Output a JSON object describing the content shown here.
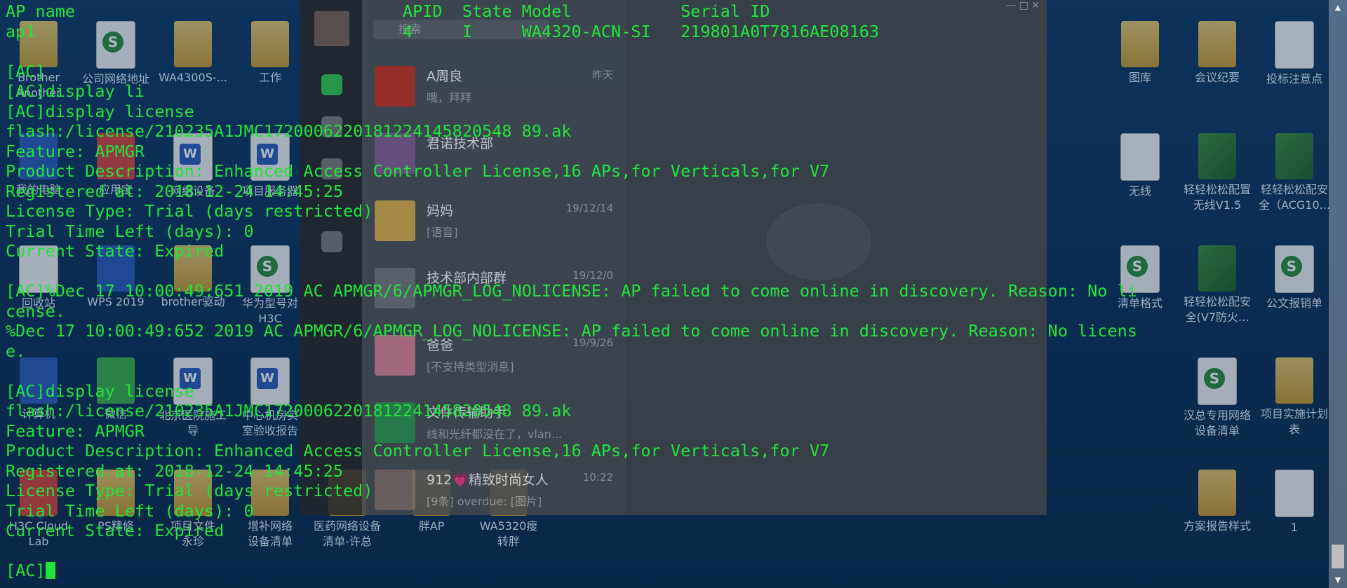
{
  "desktop": {
    "icons": [
      {
        "label": "Brother\nAnother",
        "kind": "folder"
      },
      {
        "label": "公司网络地址",
        "kind": "excel"
      },
      {
        "label": "WA4300S-...",
        "kind": "folder"
      },
      {
        "label": "工作",
        "kind": "folder"
      },
      {
        "label": "我的电脑",
        "kind": "blue"
      },
      {
        "label": "应用宝",
        "kind": "red"
      },
      {
        "label": "网络设备",
        "kind": "word"
      },
      {
        "label": "项目服务器",
        "kind": "word"
      },
      {
        "label": "回收站",
        "kind": "doc"
      },
      {
        "label": "WPS 2019",
        "kind": "blue"
      },
      {
        "label": "brother驱动",
        "kind": "folder"
      },
      {
        "label": "华为型号对\nH3C",
        "kind": "excel"
      },
      {
        "label": "计算机",
        "kind": "blue"
      },
      {
        "label": "微信",
        "kind": "green"
      },
      {
        "label": "北京医院施工\n导",
        "kind": "word"
      },
      {
        "label": "中心机房实\n室验收报告",
        "kind": "word"
      },
      {
        "label": "H3C Cloud\nLab",
        "kind": "red"
      },
      {
        "label": "PS精修",
        "kind": "folder"
      },
      {
        "label": "项目文件\n永珍",
        "kind": "folder"
      },
      {
        "label": "增补网络\n设备清单",
        "kind": "folder"
      },
      {
        "label": "医药网络设备\n清单-许总",
        "kind": "folder"
      },
      {
        "label": "胖AP",
        "kind": "folder"
      },
      {
        "label": "WA5320瘦\n转胖",
        "kind": "folder"
      },
      {
        "label": "图库",
        "kind": "folder"
      },
      {
        "label": "会议纪要",
        "kind": "folder"
      },
      {
        "label": "投标注意点",
        "kind": "doc"
      },
      {
        "label": "无线",
        "kind": "doc"
      },
      {
        "label": "轻轻松松配置\n无线V1.5",
        "kind": "book"
      },
      {
        "label": "轻轻松松配安\n全（ACG10...",
        "kind": "book"
      },
      {
        "label": "清单格式",
        "kind": "excel"
      },
      {
        "label": "轻轻松松配安\n全(V7防火...",
        "kind": "book"
      },
      {
        "label": "公文报销单",
        "kind": "excel"
      },
      {
        "label": "汉总专用网络\n设备清单",
        "kind": "excel"
      },
      {
        "label": "项目实施计划\n表",
        "kind": "folder"
      },
      {
        "label": "方案报告样式",
        "kind": "folder"
      },
      {
        "label": "1",
        "kind": "doc"
      }
    ]
  },
  "chat": {
    "search_placeholder": "搜索",
    "items": [
      {
        "name": "A周良",
        "preview": "哦，拜拜",
        "time": "昨天"
      },
      {
        "name": "君诺技术部",
        "preview": "",
        "time": ""
      },
      {
        "name": "妈妈",
        "preview": "[语音]",
        "time": "19/12/14"
      },
      {
        "name": "技术部内部群",
        "preview": "",
        "time": "19/12/0"
      },
      {
        "name": "爸爸",
        "preview": "[不支持类型消息]",
        "time": "19/9/26"
      },
      {
        "name": "文件传输助手",
        "preview": "线和光纤都没在了，vlan...",
        "time": ""
      },
      {
        "name": "912💗精致时尚女人",
        "preview": "[9条] overdue: [图片]",
        "time": "10:22"
      }
    ],
    "window_controls": "— □ ✕"
  },
  "terminal": {
    "lines": [
      "AP name                                 APID  State Model           Serial ID",
      "ap1                                     4     I     WA4320-ACN-SI   219801A0T7816AE08163",
      "",
      "[AC]",
      "[AC]display li",
      "[AC]display license",
      "flash:/license/210235A1JMC1720006220181224145820548 89.ak",
      "Feature: APMGR",
      "Product Description: Enhanced Access Controller License,16 APs,for Verticals,for V7",
      "Registered at: 2018-12-24 14:45:25",
      "License Type: Trial (days restricted)",
      "Trial Time Left (days): 0",
      "Current State: Expired",
      "",
      "[AC]%Dec 17 10:00:49:651 2019 AC APMGR/6/APMGR_LOG_NOLICENSE: AP failed to come online in discovery. Reason: No li",
      "cense.",
      "%Dec 17 10:00:49:652 2019 AC APMGR/6/APMGR_LOG_NOLICENSE: AP failed to come online in discovery. Reason: No licens",
      "e.",
      "",
      "[AC]display license",
      "flash:/license/210235A1JMC1720006220181224145820548 89.ak",
      "Feature: APMGR",
      "Product Description: Enhanced Access Controller License,16 APs,for Verticals,for V7",
      "Registered at: 2018-12-24 14:45:25",
      "License Type: Trial (days restricted)",
      "Trial Time Left (days): 0",
      "Current State: Expired",
      "",
      "[AC]"
    ]
  },
  "colors": {
    "terminal_text": "#20e33a",
    "desktop_bg": "#0e3560"
  }
}
